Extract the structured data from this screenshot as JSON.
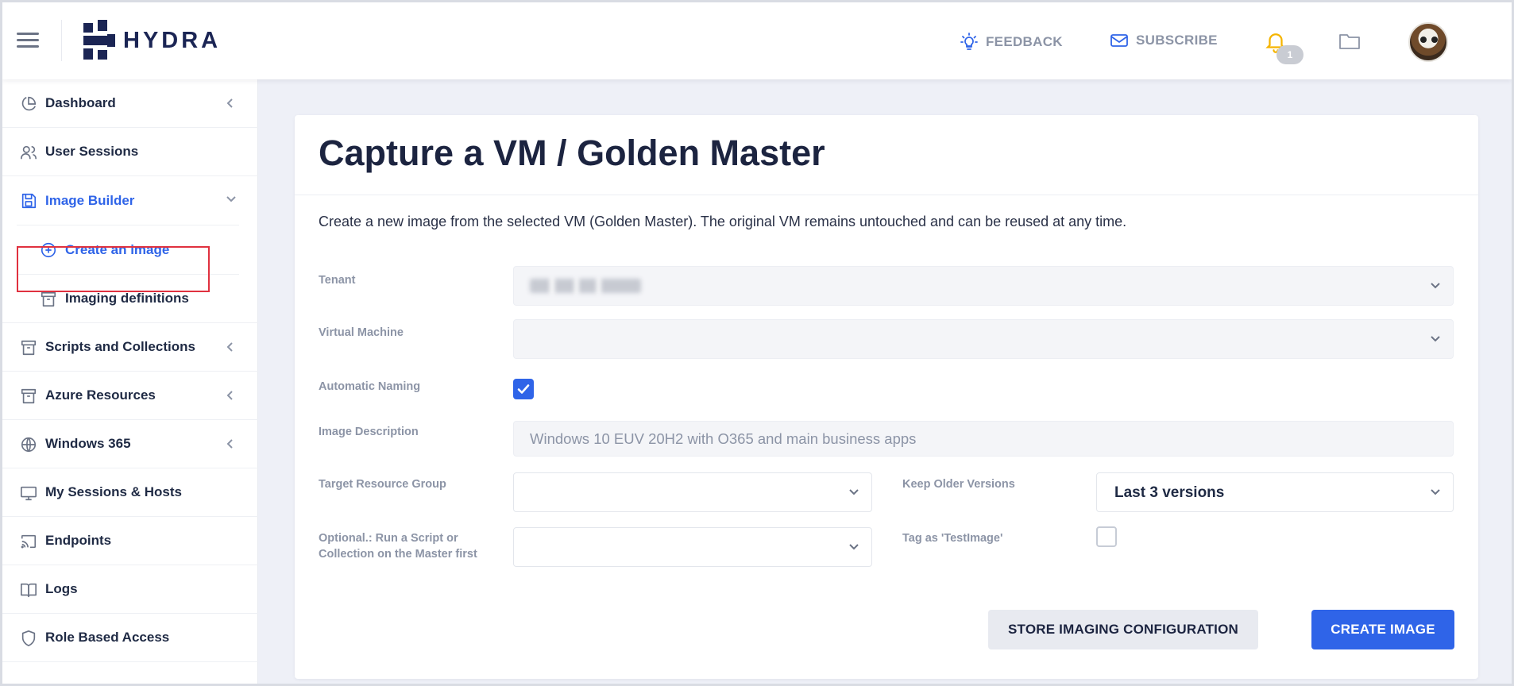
{
  "header": {
    "logo_text": "HYDRA",
    "feedback_label": "FEEDBACK",
    "subscribe_label": "SUBSCRIBE",
    "notification_count": "1",
    "accent_color": "#2f64e8",
    "bell_color": "#f5b400"
  },
  "sidebar": {
    "items": [
      {
        "label": "Dashboard",
        "icon": "pie-chart-icon"
      },
      {
        "label": "User Sessions",
        "icon": "users-icon"
      },
      {
        "label": "Image Builder",
        "icon": "save-icon"
      },
      {
        "label": "Create an image",
        "icon": "plus-circle-icon"
      },
      {
        "label": "Imaging definitions",
        "icon": "archive-icon"
      },
      {
        "label": "Scripts and Collections",
        "icon": "archive-icon"
      },
      {
        "label": "Azure Resources",
        "icon": "archive-icon"
      },
      {
        "label": "Windows 365",
        "icon": "globe-icon"
      },
      {
        "label": "My Sessions & Hosts",
        "icon": "monitor-icon"
      },
      {
        "label": "Endpoints",
        "icon": "cast-icon"
      },
      {
        "label": "Logs",
        "icon": "book-icon"
      },
      {
        "label": "Role Based Access",
        "icon": "shield-icon"
      }
    ],
    "highlight_color": "#e0313f"
  },
  "main": {
    "title": "Capture a VM / Golden Master",
    "description": "Create a new image from the selected VM (Golden Master). The original VM remains untouched and can be reused at any time.",
    "fields": {
      "tenant_label": "Tenant",
      "vm_label": "Virtual Machine",
      "auto_naming_label": "Automatic Naming",
      "auto_naming_checked": true,
      "image_desc_label": "Image Description",
      "image_desc_placeholder": "Windows 10 EUV 20H2 with O365 and main business apps",
      "target_rg_label": "Target Resource Group",
      "keep_versions_label": "Keep Older Versions",
      "keep_versions_value": "Last 3 versions",
      "optional_script_label_line1": "Optional.: Run a Script or",
      "optional_script_label_line2": "Collection on the Master first",
      "tag_label": "Tag as 'TestImage'",
      "tag_checked": false
    },
    "buttons": {
      "store_label": "STORE IMAGING CONFIGURATION",
      "create_label": "CREATE IMAGE"
    }
  }
}
